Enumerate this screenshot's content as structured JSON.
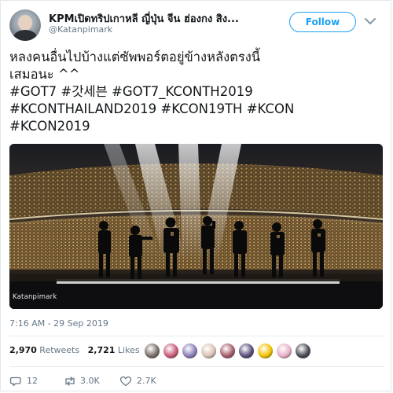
{
  "user": {
    "display_name": "KPMเปิดทริปเกาหลี ญี่ปุ่น จีน ฮ่องกง สิง...",
    "handle": "@Katanpimark",
    "avatar_icon": "profile-photo"
  },
  "follow_button": {
    "label": "Follow"
  },
  "tweet": {
    "lines": [
      "หลงคนอื่นไปบ้างแต่ซัพพอร์ตอยู่ข้างหลังตรงนี้",
      "เสมอนะ ^^",
      "#GOT7 #갓세븐 #GOT7_KCONTH2019",
      "#KCONTHAILAND2019 #KCON19TH #KCON",
      "#KCON2019"
    ],
    "photo_watermark": "Katanpimark",
    "timestamp": "7:16 AM - 29 Sep 2019"
  },
  "stats": {
    "retweets_count": "2,970",
    "retweets_label": "Retweets",
    "likes_count": "2,721",
    "likes_label": "Likes",
    "liker_avatars": [
      "#7a6f6a",
      "#c95b7a",
      "#8b7fb8",
      "#d9c2b5",
      "#a85c6b",
      "#5c4e7a",
      "#f2c200",
      "#e8b0c8",
      "#4a4a55"
    ]
  },
  "actions": {
    "reply_count": "12",
    "retweet_count": "3.0K",
    "like_count": "2.7K"
  },
  "colors": {
    "accent": "#1da1f2",
    "text": "#14171a",
    "muted": "#657786",
    "hashtag_text": "#14171a"
  }
}
